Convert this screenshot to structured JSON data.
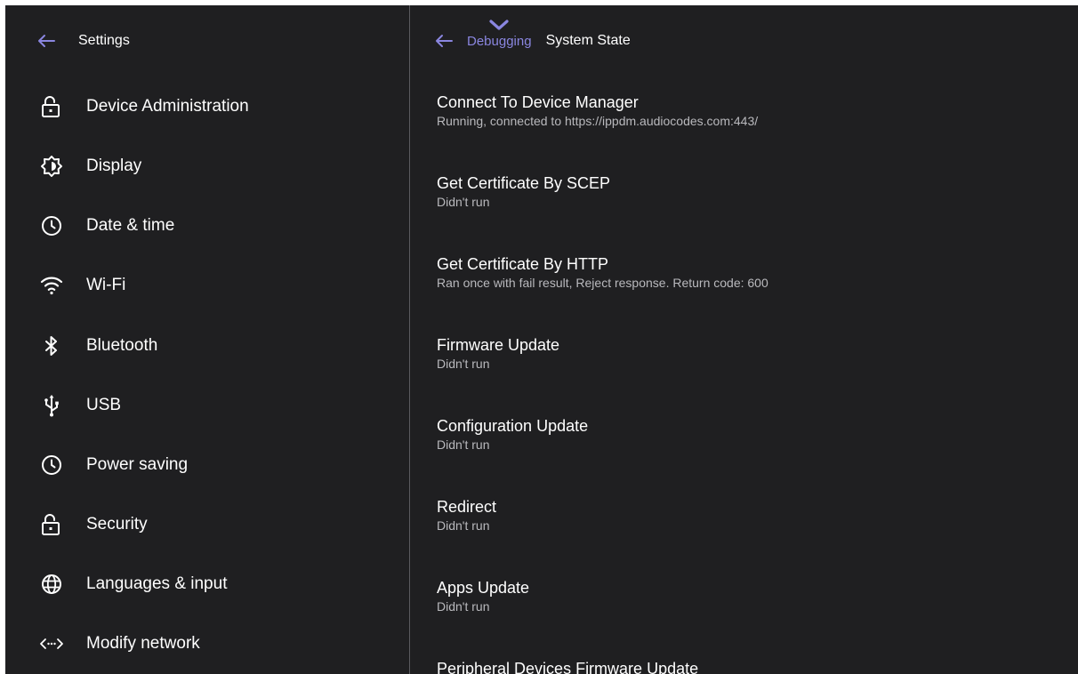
{
  "left_panel": {
    "title": "Settings",
    "items": [
      {
        "label": "Device Administration",
        "icon": "lock-open-icon"
      },
      {
        "label": "Display",
        "icon": "brightness-icon"
      },
      {
        "label": "Date & time",
        "icon": "clock-icon"
      },
      {
        "label": "Wi-Fi",
        "icon": "wifi-icon"
      },
      {
        "label": "Bluetooth",
        "icon": "bluetooth-icon"
      },
      {
        "label": "USB",
        "icon": "usb-icon"
      },
      {
        "label": "Power saving",
        "icon": "clock-icon"
      },
      {
        "label": "Security",
        "icon": "lock-open-icon"
      },
      {
        "label": "Languages & input",
        "icon": "globe-icon"
      },
      {
        "label": "Modify network",
        "icon": "network-code-icon"
      }
    ]
  },
  "right_panel": {
    "breadcrumb": "Debugging",
    "title": "System State",
    "items": [
      {
        "title": "Connect To Device Manager",
        "subtitle": "Running, connected to https://ippdm.audiocodes.com:443/"
      },
      {
        "title": "Get Certificate By SCEP",
        "subtitle": "Didn't run"
      },
      {
        "title": "Get Certificate By HTTP",
        "subtitle": "Ran once with fail result, Reject response. Return code: 600"
      },
      {
        "title": "Firmware Update",
        "subtitle": "Didn't run"
      },
      {
        "title": "Configuration Update",
        "subtitle": "Didn't run"
      },
      {
        "title": "Redirect",
        "subtitle": "Didn't run"
      },
      {
        "title": "Apps Update",
        "subtitle": "Didn't run"
      },
      {
        "title": "Peripheral Devices Firmware Update",
        "subtitle": ""
      }
    ]
  },
  "colors": {
    "background": "#1f1f21",
    "accent": "#8a86e0",
    "text": "#ffffff",
    "secondary_text": "#b9b9bd",
    "divider": "#5a5a5e"
  }
}
